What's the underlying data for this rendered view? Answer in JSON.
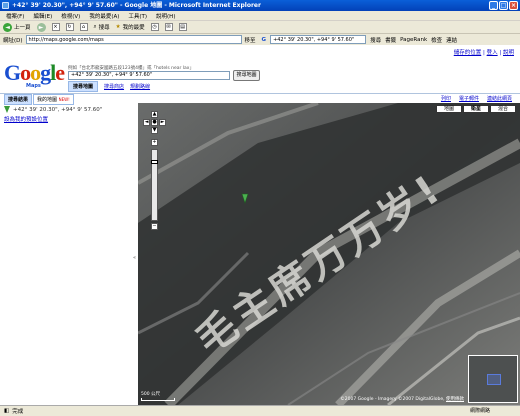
{
  "window": {
    "title": "+42° 39' 20.30\", +94° 9' 57.60\" - Google 地圖 - Microsoft Internet Explorer",
    "buttons": [
      "_",
      "□",
      "×"
    ]
  },
  "menubar": [
    "檔案(F)",
    "編輯(E)",
    "檢視(V)",
    "我的最愛(A)",
    "工具(T)",
    "說明(H)"
  ],
  "toolbar": {
    "back": "上一頁",
    "search": "搜尋",
    "favorites": "我的最愛"
  },
  "address": {
    "label": "網址(D)",
    "url": "http://maps.google.com/maps",
    "go": "移至",
    "links": "連結"
  },
  "google_toolbar": {
    "query": "+42° 39' 20.30\", +94° 9' 57.60\"",
    "search_label": "搜尋",
    "bookmarks": "書籤",
    "pagerank": "PageRank",
    "check": "檢查"
  },
  "page": {
    "top_links": [
      "儲存的位置",
      "登入",
      "說明"
    ],
    "logo_sub": "Maps",
    "hint": "例如「台北市龍安國路五段123號4樓」或「hotels near lax」",
    "query": "+42° 39' 20.30\", +94° 9' 57.60\"",
    "search_button": "搜尋地圖",
    "tabs": {
      "active": "搜尋地圖",
      "others": [
        "搜尋商店",
        "規劃路線"
      ]
    },
    "util_links": [
      "列印",
      "電子郵件",
      "連結此網頁"
    ],
    "left_tabs": {
      "results": "搜尋結果",
      "mymaps": "我的地圖",
      "new_badge": "NEW!"
    },
    "result": {
      "title": "+42° 39' 20.30\", +94° 9' 57.60\"",
      "link": "設為我的預設位置"
    },
    "collapse": "«"
  },
  "map": {
    "types": [
      "地圖",
      "衛星",
      "混合"
    ],
    "active_type": "衛星",
    "nav": {
      "up": "▲",
      "left": "◄",
      "right": "►",
      "down": "▼",
      "home": "●",
      "plus": "+",
      "minus": "−"
    },
    "scale": "500 公尺",
    "copyright": "©2007 Google - Imagery ©2007 DigitalGlobe, ",
    "terms": "使用條款",
    "ground_text": [
      "毛",
      "主",
      "席",
      "万",
      "万",
      "岁",
      "!"
    ],
    "colors": {
      "terrain_dark": "#2f3131",
      "terrain_light": "#b9b9b4",
      "letters": "#d7d7d2"
    }
  },
  "status": {
    "left": "完成",
    "right": "網際網路"
  }
}
